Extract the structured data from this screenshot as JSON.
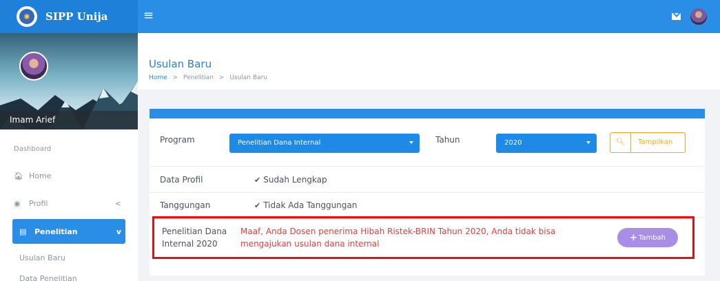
{
  "app": {
    "name": "SIPP Unija"
  },
  "topbar": {
    "menu_icon": "hamburger-icon",
    "mail_icon": "mail-icon",
    "avatar_icon": "user-avatar"
  },
  "sidebar": {
    "user_name": "Imam Arief",
    "heading": "Dashboard",
    "items": [
      {
        "label": "Home",
        "icon": "home-icon"
      },
      {
        "label": "Profil",
        "icon": "user-circle-icon",
        "chevron": "<"
      },
      {
        "label": "Penelitian",
        "icon": "file-icon",
        "chevron": "v",
        "active": true
      }
    ],
    "subitems": [
      "Usulan Baru",
      "Data Penelitian"
    ]
  },
  "page": {
    "title": "Usulan Baru",
    "breadcrumb": [
      "Home",
      "Penelitian",
      "Usulan Baru"
    ],
    "breadcrumb_sep": ">"
  },
  "form": {
    "program_label": "Program",
    "program_value": "Penelitian Dana Internal",
    "tahun_label": "Tahun",
    "tahun_value": "2020",
    "tampilkan_label": "Tampilkan"
  },
  "rows": {
    "data_profil_label": "Data Profil",
    "data_profil_value": "Sudah Lengkap",
    "tanggungan_label": "Tanggungan",
    "tanggungan_value": "Tidak Ada Tanggungan",
    "check_glyph": "✔"
  },
  "alert": {
    "label": "Penelitian Dana Internal 2020",
    "message": "Maaf, Anda Dosen penerima Hibah Ristek-BRIN Tahun 2020, Anda tidak bisa mengajukan usulan dana internal",
    "button_label": "Tambah",
    "button_plus": "+"
  },
  "colors": {
    "primary": "#2a8ee6",
    "alert_border": "#f20a0a",
    "alert_text": "#f03a3a",
    "warning": "#f5a623",
    "button_purple": "#a98ee8"
  }
}
